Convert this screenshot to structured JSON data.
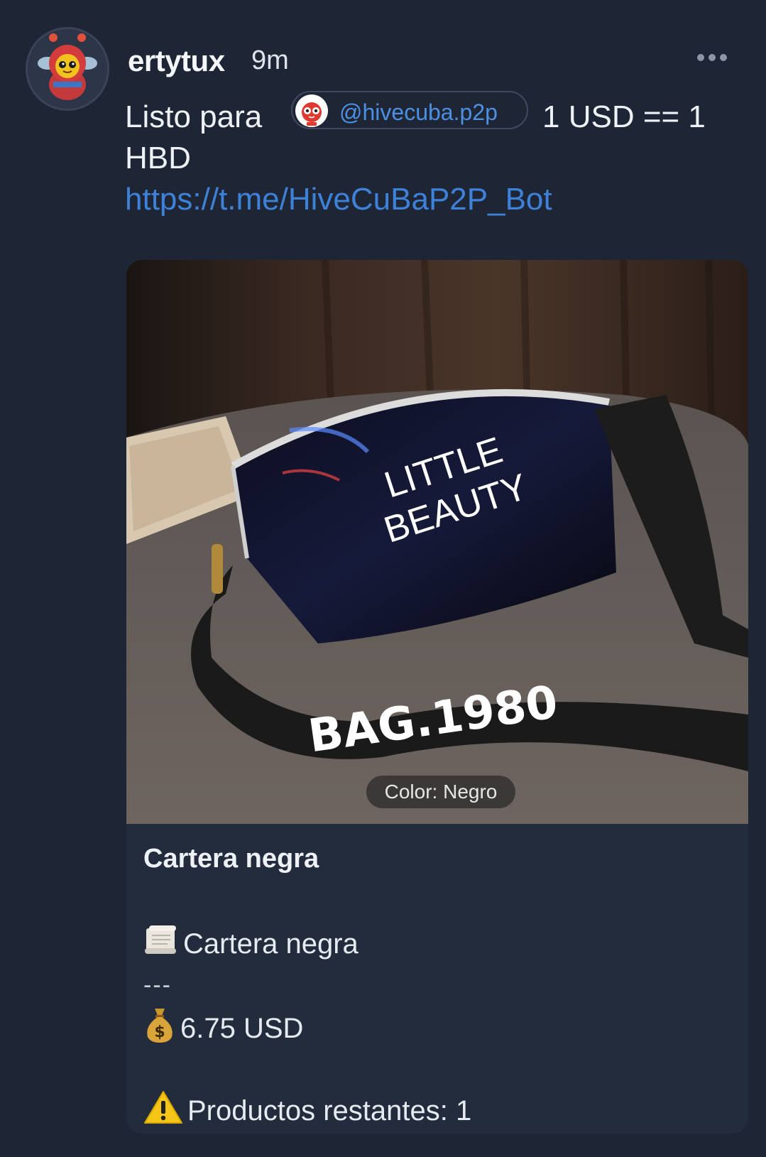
{
  "post": {
    "username": "ertytux",
    "time": "9m",
    "text_before_mention": "Listo para",
    "mention": "@hivecuba.p2p",
    "text_after_mention": "1 USD == 1",
    "text_line2": "HBD",
    "link": "https://t.me/HiveCuBaP2P_Bot"
  },
  "card": {
    "image_label": "Color: Negro",
    "image_print_1": "LITTLE",
    "image_print_2": "BEAUTY",
    "image_strap_print": "BAG.1980",
    "title": "Cartera negra",
    "product_name": "Cartera negra",
    "separator": "---",
    "price": "6.75 USD",
    "stock": "Productos restantes: 1"
  },
  "icons": {
    "avatar": "bee-mascot-avatar",
    "mention": "hive-p2p-logo-icon",
    "menu": "more-horizontal-icon",
    "product": "scroll-icon",
    "price": "money-bag-icon",
    "stock": "warning-icon"
  }
}
